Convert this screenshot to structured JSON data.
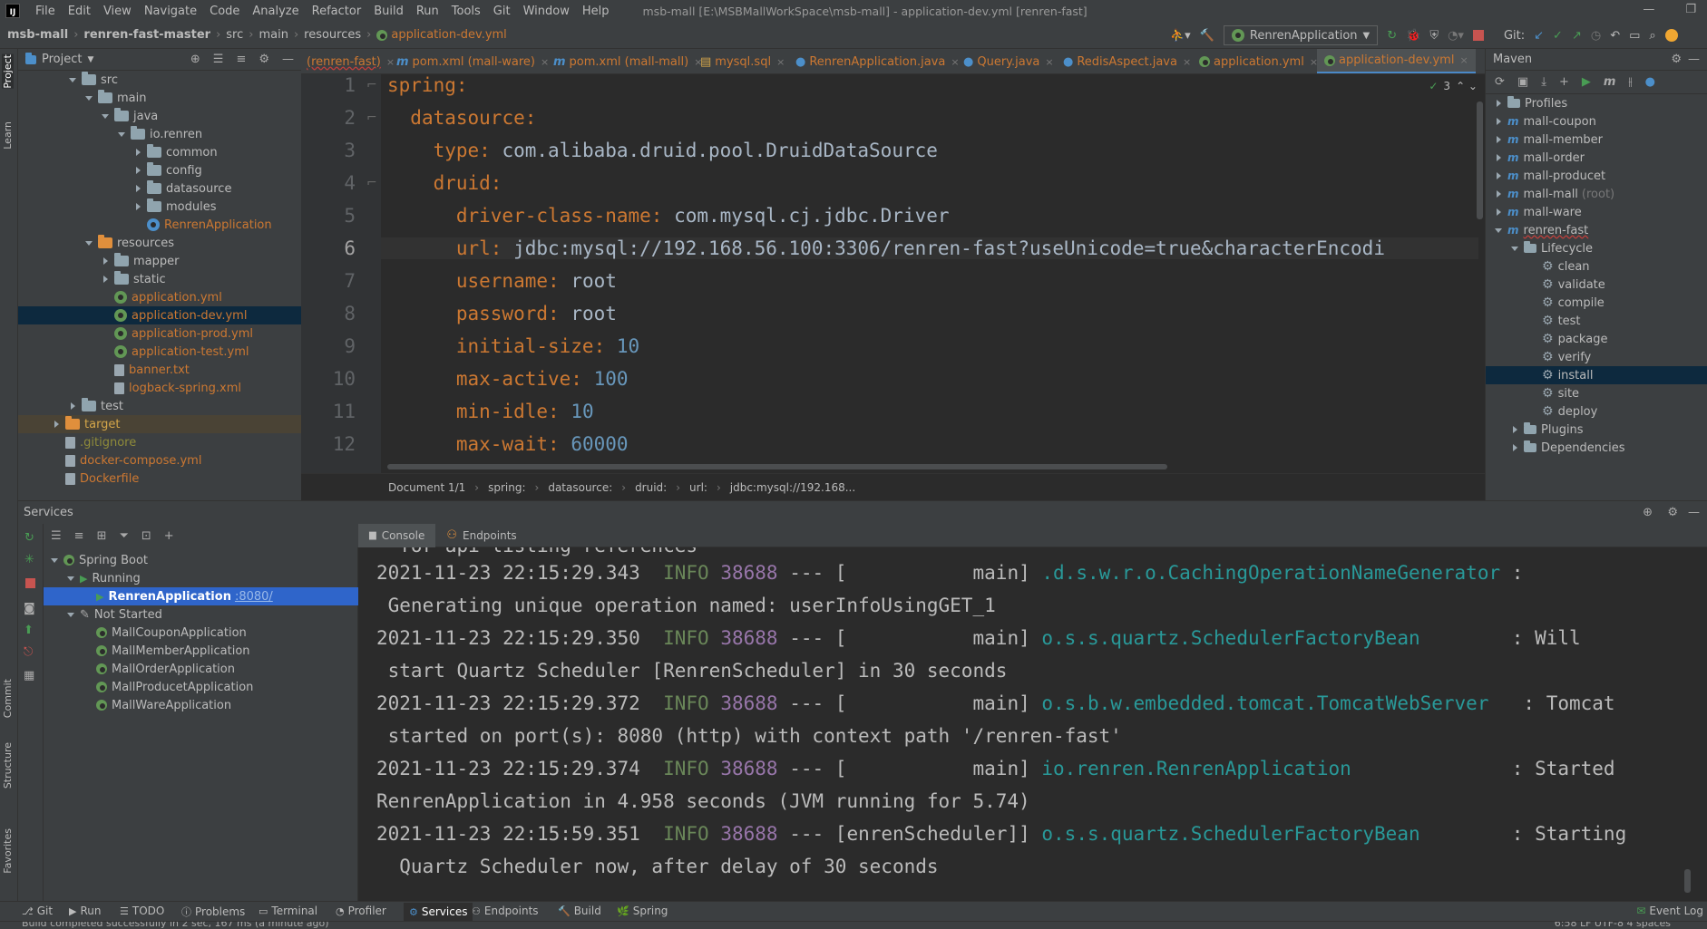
{
  "window": {
    "app_icon": "IJ",
    "menus": [
      "File",
      "Edit",
      "View",
      "Navigate",
      "Code",
      "Analyze",
      "Refactor",
      "Build",
      "Run",
      "Tools",
      "Git",
      "Window",
      "Help"
    ],
    "title": "msb-mall [E:\\MSBMallWorkSpace\\msb-mall] - application-dev.yml [renren-fast]"
  },
  "breadcrumb": [
    "msb-mall",
    "renren-fast-master",
    "src",
    "main",
    "resources",
    "application-dev.yml"
  ],
  "run_config": "RenrenApplication",
  "git_label": "Git:",
  "project": {
    "title": "Project",
    "items": [
      {
        "label": "src",
        "type": "folder"
      },
      {
        "label": "main",
        "type": "folder"
      },
      {
        "label": "java",
        "type": "folder"
      },
      {
        "label": "io.renren",
        "type": "folder"
      },
      {
        "label": "common",
        "type": "folder"
      },
      {
        "label": "config",
        "type": "folder"
      },
      {
        "label": "datasource",
        "type": "folder"
      },
      {
        "label": "modules",
        "type": "folder"
      },
      {
        "label": "RenrenApplication",
        "type": "class"
      },
      {
        "label": "resources",
        "type": "folder"
      },
      {
        "label": "mapper",
        "type": "folder"
      },
      {
        "label": "static",
        "type": "folder"
      },
      {
        "label": "application.yml",
        "type": "yml"
      },
      {
        "label": "application-dev.yml",
        "type": "yml"
      },
      {
        "label": "application-prod.yml",
        "type": "yml"
      },
      {
        "label": "application-test.yml",
        "type": "yml"
      },
      {
        "label": "banner.txt",
        "type": "txt"
      },
      {
        "label": "logback-spring.xml",
        "type": "xml"
      },
      {
        "label": "test",
        "type": "folder"
      },
      {
        "label": "target",
        "type": "folder"
      },
      {
        "label": ".gitignore",
        "type": "file"
      },
      {
        "label": "docker-compose.yml",
        "type": "file"
      },
      {
        "label": "Dockerfile",
        "type": "file"
      }
    ]
  },
  "tabs": [
    "(renren-fast)",
    "pom.xml (mall-ware)",
    "pom.xml (mall-mall)",
    "mysql.sql",
    "RenrenApplication.java",
    "Query.java",
    "RedisAspect.java",
    "application.yml",
    "application-dev.yml"
  ],
  "editor": {
    "lines": [
      {
        "n": "1",
        "key": "spring",
        "val": ""
      },
      {
        "n": "2",
        "key": "datasource",
        "val": ""
      },
      {
        "n": "3",
        "key": "type",
        "val": "com.alibaba.druid.pool.DruidDataSource"
      },
      {
        "n": "4",
        "key": "druid",
        "val": ""
      },
      {
        "n": "5",
        "key": "driver-class-name",
        "val": "com.mysql.cj.jdbc.Driver"
      },
      {
        "n": "6",
        "key": "url",
        "val": "jdbc:mysql://192.168.56.100:3306/renren-fast?useUnicode=true&characterEncodi"
      },
      {
        "n": "7",
        "key": "username",
        "val": "root"
      },
      {
        "n": "8",
        "key": "password",
        "val": "root"
      },
      {
        "n": "9",
        "key": "initial-size",
        "val": "10"
      },
      {
        "n": "10",
        "key": "max-active",
        "val": "100"
      },
      {
        "n": "11",
        "key": "min-idle",
        "val": "10"
      },
      {
        "n": "12",
        "key": "max-wait",
        "val": "60000"
      }
    ],
    "warning_count": "3"
  },
  "editor_crumbs": [
    "Document 1/1",
    "spring:",
    "datasource:",
    "druid:",
    "url:",
    "jdbc:mysql://192.168..."
  ],
  "maven": {
    "title": "Maven",
    "items": [
      {
        "label": "Profiles"
      },
      {
        "label": "mall-coupon"
      },
      {
        "label": "mall-member"
      },
      {
        "label": "mall-order"
      },
      {
        "label": "mall-producet"
      },
      {
        "label": "mall-mall",
        "suffix": "(root)"
      },
      {
        "label": "mall-ware"
      },
      {
        "label": "renren-fast"
      },
      {
        "label": "Lifecycle"
      },
      {
        "label": "clean"
      },
      {
        "label": "validate"
      },
      {
        "label": "compile"
      },
      {
        "label": "test"
      },
      {
        "label": "package"
      },
      {
        "label": "verify"
      },
      {
        "label": "install"
      },
      {
        "label": "site"
      },
      {
        "label": "deploy"
      },
      {
        "label": "Plugins"
      },
      {
        "label": "Dependencies"
      }
    ]
  },
  "services": {
    "title": "Services",
    "tree": [
      {
        "label": "Spring Boot"
      },
      {
        "label": "Running"
      },
      {
        "label": "RenrenApplication",
        "port": ":8080/"
      },
      {
        "label": "Not Started"
      },
      {
        "label": "MallCouponApplication"
      },
      {
        "label": "MallMemberApplication"
      },
      {
        "label": "MallOrderApplication"
      },
      {
        "label": "MallProducetApplication"
      },
      {
        "label": "MallWareApplication"
      }
    ],
    "console_tabs": [
      "Console",
      "Endpoints"
    ]
  },
  "console": {
    "partial_top": "  for api listing references",
    "entries": [
      {
        "ts": "2021-11-23 22:15:29.343",
        "level": "INFO",
        "pid": "38688",
        "sep": "---",
        "thread": "[           main]",
        "logger": ".d.s.w.r.o.CachingOperationNameGenerator",
        "msg": ": ",
        "cont": " Generating unique operation named: userInfoUsingGET_1"
      },
      {
        "ts": "2021-11-23 22:15:29.350",
        "level": "INFO",
        "pid": "38688",
        "sep": "---",
        "thread": "[           main]",
        "logger": "o.s.s.quartz.SchedulerFactoryBean",
        "msg": "       : Will",
        "cont": " start Quartz Scheduler [RenrenScheduler] in 30 seconds"
      },
      {
        "ts": "2021-11-23 22:15:29.372",
        "level": "INFO",
        "pid": "38688",
        "sep": "---",
        "thread": "[           main]",
        "logger": "o.s.b.w.embedded.tomcat.TomcatWebServer",
        "msg": "  : Tomcat",
        "cont": " started on port(s): 8080 (http) with context path '/renren-fast'"
      },
      {
        "ts": "2021-11-23 22:15:29.374",
        "level": "INFO",
        "pid": "38688",
        "sep": "---",
        "thread": "[           main]",
        "logger": "io.renren.RenrenApplication",
        "msg": "             : Started",
        "cont": "RenrenApplication in 4.958 seconds (JVM running for 5.74)"
      },
      {
        "ts": "2021-11-23 22:15:59.351",
        "level": "INFO",
        "pid": "38688",
        "sep": "---",
        "thread": "[enrenScheduler]]",
        "logger": "o.s.s.quartz.SchedulerFactoryBean",
        "msg": "       : Starting",
        "cont": "  Quartz Scheduler now, after delay of 30 seconds"
      }
    ]
  },
  "bottom_tools": [
    "Git",
    "Run",
    "TODO",
    "Problems",
    "Terminal",
    "Profiler",
    "Services",
    "Endpoints",
    "Build",
    "Spring"
  ],
  "event_log": "Event Log",
  "status_text": "Build completed successfully in 2 sec, 167 ms (a minute ago)",
  "status_right": "6:58   LF   UTF-8   4 spaces",
  "left_strip": [
    "Project",
    "Learn",
    "Commit",
    "Structure",
    "Favorites"
  ]
}
